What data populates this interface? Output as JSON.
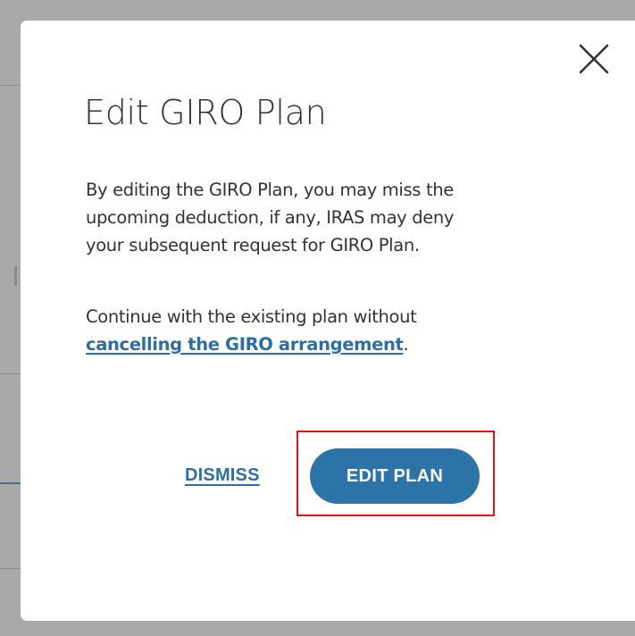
{
  "dialog": {
    "title": "Edit GIRO Plan",
    "close_icon": "close-icon",
    "paragraph1": {
      "line1": "By editing the GIRO Plan, you may miss the",
      "line2": "upcoming deduction, if any, IRAS may deny",
      "line3": "your subsequent request for GIRO Plan."
    },
    "paragraph2": {
      "line1": "Continue with the existing plan without",
      "link_text": "cancelling the GIRO arrangement",
      "trailing": "."
    },
    "buttons": {
      "dismiss_label": "DISMISS",
      "edit_plan_label": "EDIT PLAN"
    }
  },
  "colors": {
    "accent": "#2c73a8",
    "link": "#2b6fa3",
    "highlight": "#e0141e",
    "overlay": "#a9a9a9"
  }
}
